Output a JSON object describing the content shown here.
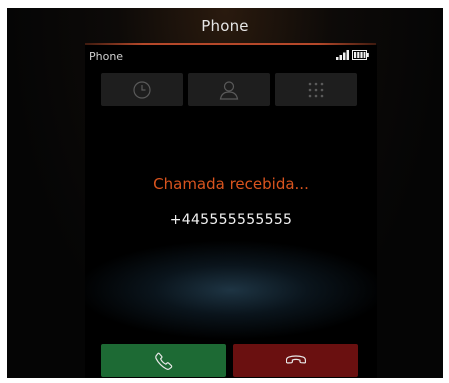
{
  "window": {
    "title": "Phone"
  },
  "statusbar": {
    "app_name": "Phone",
    "icons": [
      "signal-icon",
      "battery-icon"
    ]
  },
  "toolbar": {
    "buttons": [
      {
        "icon": "clock-icon",
        "name": "history"
      },
      {
        "icon": "person-icon",
        "name": "contacts"
      },
      {
        "icon": "dialpad-icon",
        "name": "dialpad"
      }
    ]
  },
  "call": {
    "status": "Chamada recebida...",
    "number": "+445555555555"
  },
  "actions": {
    "answer_icon": "phone-answer-icon",
    "reject_icon": "phone-reject-icon"
  },
  "colors": {
    "accent": "#d9541e",
    "answer": "#1d6a34",
    "reject": "#6a1010"
  }
}
